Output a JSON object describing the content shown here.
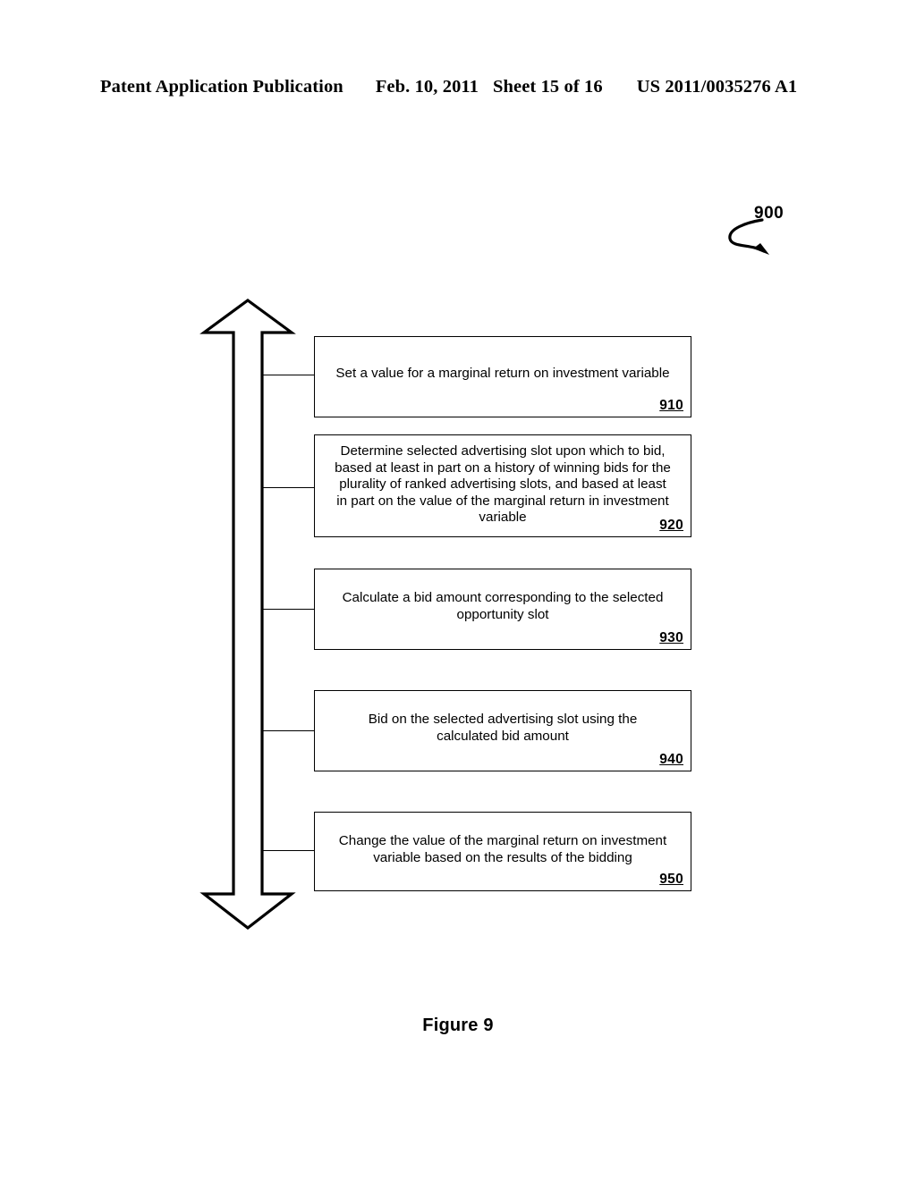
{
  "header": {
    "publication": "Patent Application Publication",
    "date": "Feb. 10, 2011",
    "sheet": "Sheet 15 of 16",
    "patent_number": "US 2011/0035276 A1"
  },
  "figure": {
    "reference_numeral": "900",
    "caption": "Figure 9",
    "arrow_icon": "double-headed-vertical-arrow",
    "lead_line_icon": "curved-lead-arrow"
  },
  "steps": [
    {
      "id": "910",
      "number": "910",
      "text": "Set a value for a marginal return on investment variable"
    },
    {
      "id": "920",
      "number": "920",
      "text": "Determine selected advertising slot upon which to bid,\nbased at least in part on a history of winning bids for the\nplurality of ranked advertising slots, and based at least\nin part on the value of the marginal return in investment\nvariable"
    },
    {
      "id": "930",
      "number": "930",
      "text": "Calculate a bid amount corresponding to the selected\nopportunity slot"
    },
    {
      "id": "940",
      "number": "940",
      "text": "Bid on the selected advertising slot using the\ncalculated bid amount"
    },
    {
      "id": "950",
      "number": "950",
      "text": "Change the value of the marginal return on investment\nvariable based on the results of the bidding"
    }
  ],
  "colors": {
    "ink": "#000000",
    "paper": "#ffffff"
  }
}
